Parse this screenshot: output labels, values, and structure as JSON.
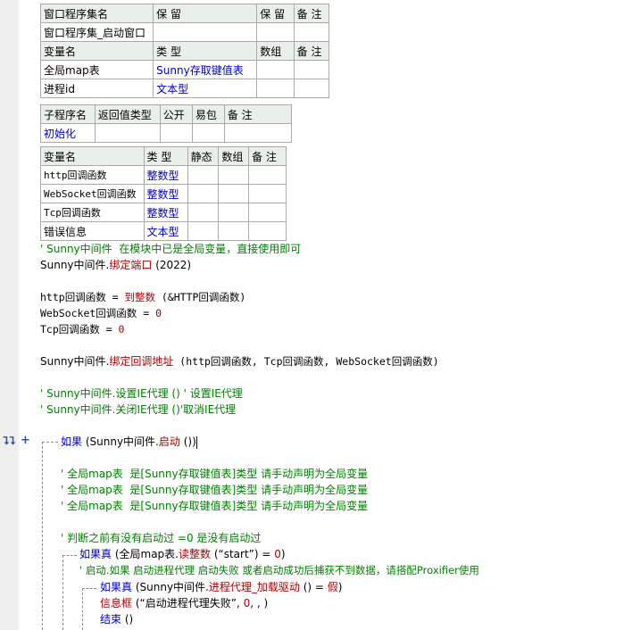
{
  "table_window": {
    "header": [
      "窗口程序集名",
      "保 留",
      "保 留",
      "备 注"
    ],
    "row": [
      "窗口程序集_启动窗口",
      "",
      "",
      ""
    ],
    "var_header": [
      "变量名",
      "类 型",
      "数组",
      "备 注"
    ],
    "vars": [
      {
        "name": "全局map表",
        "type": "Sunny存取键值表",
        "array": "",
        "note": ""
      },
      {
        "name": "进程id",
        "type": "文本型",
        "array": "",
        "note": ""
      }
    ]
  },
  "table_sub": {
    "header": [
      "子程序名",
      "返回值类型",
      "公开",
      "易包",
      "备 注"
    ],
    "row": [
      "初始化",
      "",
      "",
      "",
      ""
    ]
  },
  "table_locals": {
    "header": [
      "变量名",
      "类 型",
      "静态",
      "数组",
      "备 注"
    ],
    "vars": [
      {
        "name": "http回调函数",
        "type": "整数型"
      },
      {
        "name": "WebSocket回调函数",
        "type": "整数型"
      },
      {
        "name": "Tcp回调函数",
        "type": "整数型"
      },
      {
        "name": "错误信息",
        "type": "文本型"
      }
    ]
  },
  "code": {
    "c1": "' Sunny中间件  在模块中已是全局变量，直接使用即可",
    "l2a": "Sunny中间件.",
    "l2b": "绑定端口",
    "l2c": " (2022)",
    "l3a": "http回调函数 = ",
    "l3b": "到整数",
    "l3c": " (&HTTP回调函数)",
    "l4": "WebSocket回调函数 = ",
    "l4v": "0",
    "l5": "Tcp回调函数 = ",
    "l5v": "0",
    "l6a": "Sunny中间件.",
    "l6b": "绑定回调地址",
    "l6c": " (http回调函数, Tcp回调函数, WebSocket回调函数)",
    "c2": "' Sunny中间件.设置IE代理 () ' 设置IE代理",
    "c3": "' Sunny中间件.关闭IE代理 ()'取消IE代理",
    "if1a": "如果",
    "if1b": " (Sunny中间件.",
    "if1c": "启动",
    "if1d": " ())",
    "c4": "' 全局map表  是[Sunny存取键值表]类型 请手动声明为全局变量",
    "c5": "' 全局map表  是[Sunny存取键值表]类型 请手动声明为全局变量",
    "c6": "' 全局map表  是[Sunny存取键值表]类型 请手动声明为全局变量",
    "c7": "' 判断之前有没有启动过 =0 是没有启动过",
    "if2a": "如果真",
    "if2b": " (全局map表.",
    "if2c": "读整数",
    "if2d": " (“start”) = ",
    "if2e": "0",
    "if2f": ")",
    "c8": "' 启动.如果 启动进程代理 启动失败 或者启动成功后捕获不到数据，请搭配Proxifier使用",
    "if3a": "如果真",
    "if3b": " (Sunny中间件.",
    "if3c": "进程代理_加载驱动",
    "if3d": " () = ",
    "if3e": "假",
    "if3f": ")",
    "l9a": "信息框",
    "l9b": " (“启动进程代理失败”, ",
    "l9c": "0",
    "l9d": ", , )",
    "l10a": "结束",
    "l10b": " ()"
  },
  "gutter_markers": {
    "left": "⮧⮧",
    "right": "+"
  },
  "colors": {
    "keyword": "#0000cc",
    "comment": "#008000",
    "method": "#aa0000",
    "header_bg": "#e9efe9"
  }
}
